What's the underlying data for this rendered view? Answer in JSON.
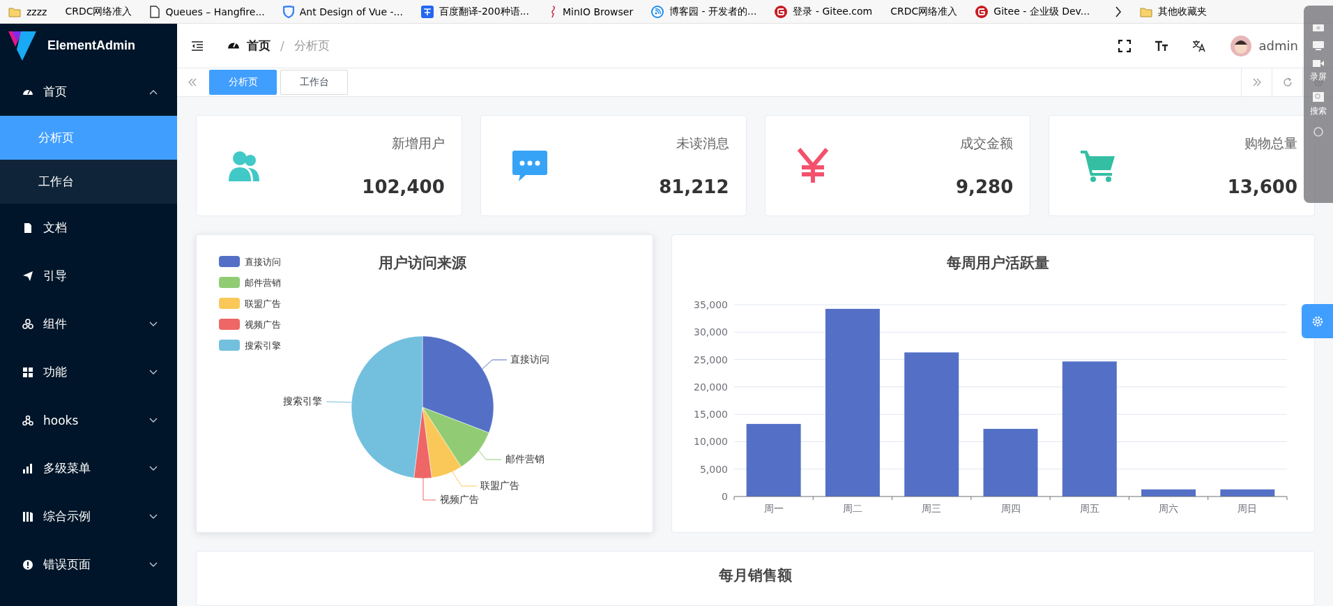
{
  "bookmarks": [
    {
      "label": "zzzz",
      "kind": "folder"
    },
    {
      "label": "CRDC网络准入",
      "kind": "plain"
    },
    {
      "label": "Queues – Hangfire...",
      "kind": "document"
    },
    {
      "label": "Ant Design of Vue -...",
      "kind": "shield"
    },
    {
      "label": "百度翻译-200种语...",
      "kind": "translate"
    },
    {
      "label": "MinIO Browser",
      "kind": "bird"
    },
    {
      "label": "博客园 - 开发者的...",
      "kind": "feed"
    },
    {
      "label": "登录 - Gitee.com",
      "kind": "gitee"
    },
    {
      "label": "CRDC网络准入",
      "kind": "plain"
    },
    {
      "label": "Gitee - 企业级 Dev...",
      "kind": "gitee"
    },
    {
      "label": "其他收藏夹",
      "kind": "folder"
    }
  ],
  "sidebar": {
    "logo": "ElementAdmin",
    "items": [
      {
        "label": "首页",
        "kind": "submenu",
        "expanded": true,
        "children": [
          {
            "label": "分析页",
            "selected": true
          },
          {
            "label": "工作台",
            "selected": false
          }
        ]
      },
      {
        "label": "文档",
        "kind": "link"
      },
      {
        "label": "引导",
        "kind": "link"
      },
      {
        "label": "组件",
        "kind": "submenu",
        "expanded": false
      },
      {
        "label": "功能",
        "kind": "submenu",
        "expanded": false
      },
      {
        "label": "hooks",
        "kind": "submenu",
        "expanded": false
      },
      {
        "label": "多级菜单",
        "kind": "submenu",
        "expanded": false
      },
      {
        "label": "综合示例",
        "kind": "submenu",
        "expanded": false
      },
      {
        "label": "错误页面",
        "kind": "submenu",
        "expanded": false
      }
    ]
  },
  "header": {
    "breadcrumb": [
      "首页",
      "分析页"
    ],
    "separator": "/",
    "user": "admin"
  },
  "tags": [
    {
      "label": "分析页",
      "selected": true
    },
    {
      "label": "工作台",
      "selected": false
    }
  ],
  "stats": [
    {
      "title": "新增用户",
      "value": "102,400",
      "color": "#40c9c6"
    },
    {
      "title": "未读消息",
      "value": "81,212",
      "color": "#36a3f7"
    },
    {
      "title": "成交金额",
      "value": "9,280",
      "color": "#f4516c"
    },
    {
      "title": "购物总量",
      "value": "13,600",
      "color": "#34bfa3"
    }
  ],
  "pie": {
    "title": "用户访问来源",
    "legend": [
      {
        "label": "直接访问",
        "color": "#5470c6"
      },
      {
        "label": "邮件营销",
        "color": "#91cc75"
      },
      {
        "label": "联盟广告",
        "color": "#fac858"
      },
      {
        "label": "视频广告",
        "color": "#ee6666"
      },
      {
        "label": "搜索引擎",
        "color": "#73c0de"
      }
    ],
    "slice_labels": [
      "直接访问",
      "邮件营销",
      "联盟广告",
      "视频广告",
      "搜索引擎"
    ]
  },
  "weekly": {
    "chart_data": {
      "type": "bar",
      "title": "每周用户活跃量",
      "categories": [
        "周一",
        "周二",
        "周三",
        "周四",
        "周五",
        "周六",
        "周日"
      ],
      "series": [
        {
          "color": "#5470c6",
          "values": [
            13250,
            34250,
            26300,
            12350,
            24650,
            1300,
            1300
          ]
        }
      ],
      "ylim": [
        0,
        35000
      ],
      "grid": true,
      "yticks": [
        {
          "value": 0,
          "label": "0"
        },
        {
          "value": 5000,
          "label": "5,000"
        },
        {
          "value": 10000,
          "label": "10,000"
        },
        {
          "value": 15000,
          "label": "15,000"
        },
        {
          "value": 20000,
          "label": "20,000"
        },
        {
          "value": 25000,
          "label": "25,000"
        },
        {
          "value": 30000,
          "label": "30,000"
        },
        {
          "value": 35000,
          "label": "35,000"
        }
      ]
    }
  },
  "monthly": {
    "title": "每月销售额"
  },
  "tool_overlay": [
    "录屏",
    "搜索"
  ]
}
